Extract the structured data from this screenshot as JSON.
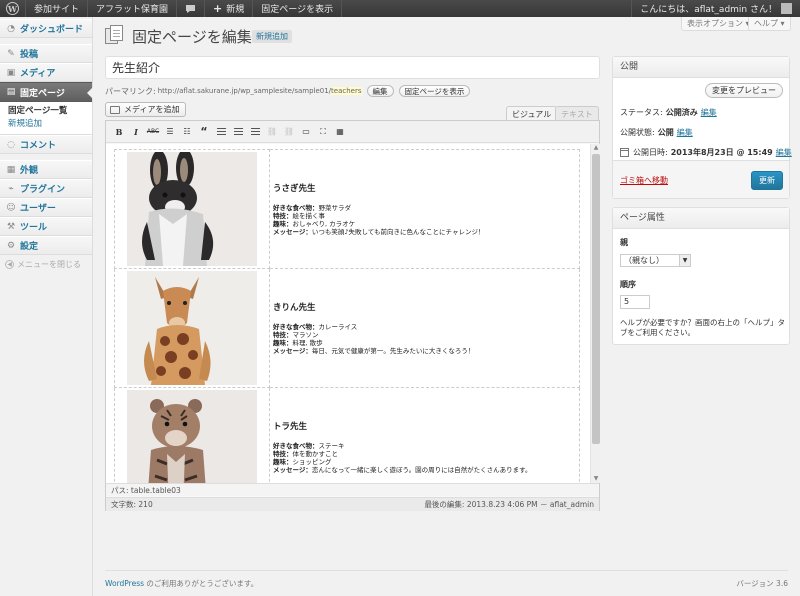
{
  "admin_bar": {
    "site": "参加サイト",
    "blog": "アフラット保育園",
    "new": "新規",
    "view_page": "固定ページを表示",
    "greeting": "こんにちは、aflat_admin さん！"
  },
  "screen_meta": {
    "options": "表示オプション ▾",
    "help": "ヘルプ ▾"
  },
  "sidebar": {
    "dashboard": "ダッシュボード",
    "posts": "投稿",
    "media": "メディア",
    "pages": "固定ページ",
    "pages_list": "固定ページ一覧",
    "pages_new": "新規追加",
    "comments": "コメント",
    "appearance": "外観",
    "plugins": "プラグイン",
    "users": "ユーザー",
    "tools": "ツール",
    "settings": "設定",
    "collapse": "メニューを閉じる"
  },
  "page": {
    "title": "固定ページを編集",
    "add_new": "新規追加",
    "post_title": "先生紹介",
    "permalink_label": "パーマリンク:",
    "permalink_url": "http://aflat.sakurane.jp/wp_samplesite/sample01/",
    "permalink_slug": "teachers",
    "edit_btn": "編集",
    "view_btn": "固定ページを表示",
    "add_media": "メディアを追加",
    "tab_visual": "ビジュアル",
    "tab_text": "テキスト"
  },
  "teachers": [
    {
      "name": "うさぎ先生",
      "food_label": "好きな食べ物：",
      "food": "野菜サラダ",
      "skill_label": "特技：",
      "skill": "絵を描く事",
      "hobby_label": "趣味：",
      "hobby": "おしゃべり, カラオケ",
      "msg_label": "メッセージ：",
      "msg": "いつも笑顔♪失敗しても前向きに色んなことにチャレンジ！"
    },
    {
      "name": "きりん先生",
      "food_label": "好きな食べ物：",
      "food": "カレーライス",
      "skill_label": "特技：",
      "skill": "マラソン",
      "hobby_label": "趣味：",
      "hobby": "料理, 散歩",
      "msg_label": "メッセージ：",
      "msg": "毎日、元気で健康が第一。先生みたいに大きくなろう！"
    },
    {
      "name": "トラ先生",
      "food_label": "好きな食べ物：",
      "food": "ステーキ",
      "skill_label": "特技：",
      "skill": "体を動かすこと",
      "hobby_label": "趣味：",
      "hobby": "ショッピング",
      "msg_label": "メッセージ：",
      "msg": "恋んになって一緒に楽しく遊ぼう。園の周りには自然がたくさんあります。"
    }
  ],
  "editor": {
    "path": "パス: table.table03",
    "word_count": "文字数: 210",
    "last_edit": "最後の編集: 2013.8.23 4:06 PM － aflat_admin"
  },
  "publish": {
    "title": "公開",
    "preview": "変更をプレビュー",
    "status_label": "ステータス:",
    "status": "公開済み",
    "visibility_label": "公開状態:",
    "visibility": "公開",
    "date_label": "公開日時:",
    "date": "2013年8月23日 @ 15:49",
    "edit": "編集",
    "trash": "ゴミ箱へ移動",
    "update": "更新"
  },
  "attributes": {
    "title": "ページ属性",
    "parent_label": "親",
    "parent_value": "（親なし）",
    "order_label": "順序",
    "order_value": "5",
    "help": "ヘルプが必要ですか？画面の右上の「ヘルプ」タブをご利用ください。"
  },
  "footer": {
    "wp": "WordPress",
    "thanks": " のご利用ありがとうございます。",
    "version": "バージョン 3.6"
  }
}
